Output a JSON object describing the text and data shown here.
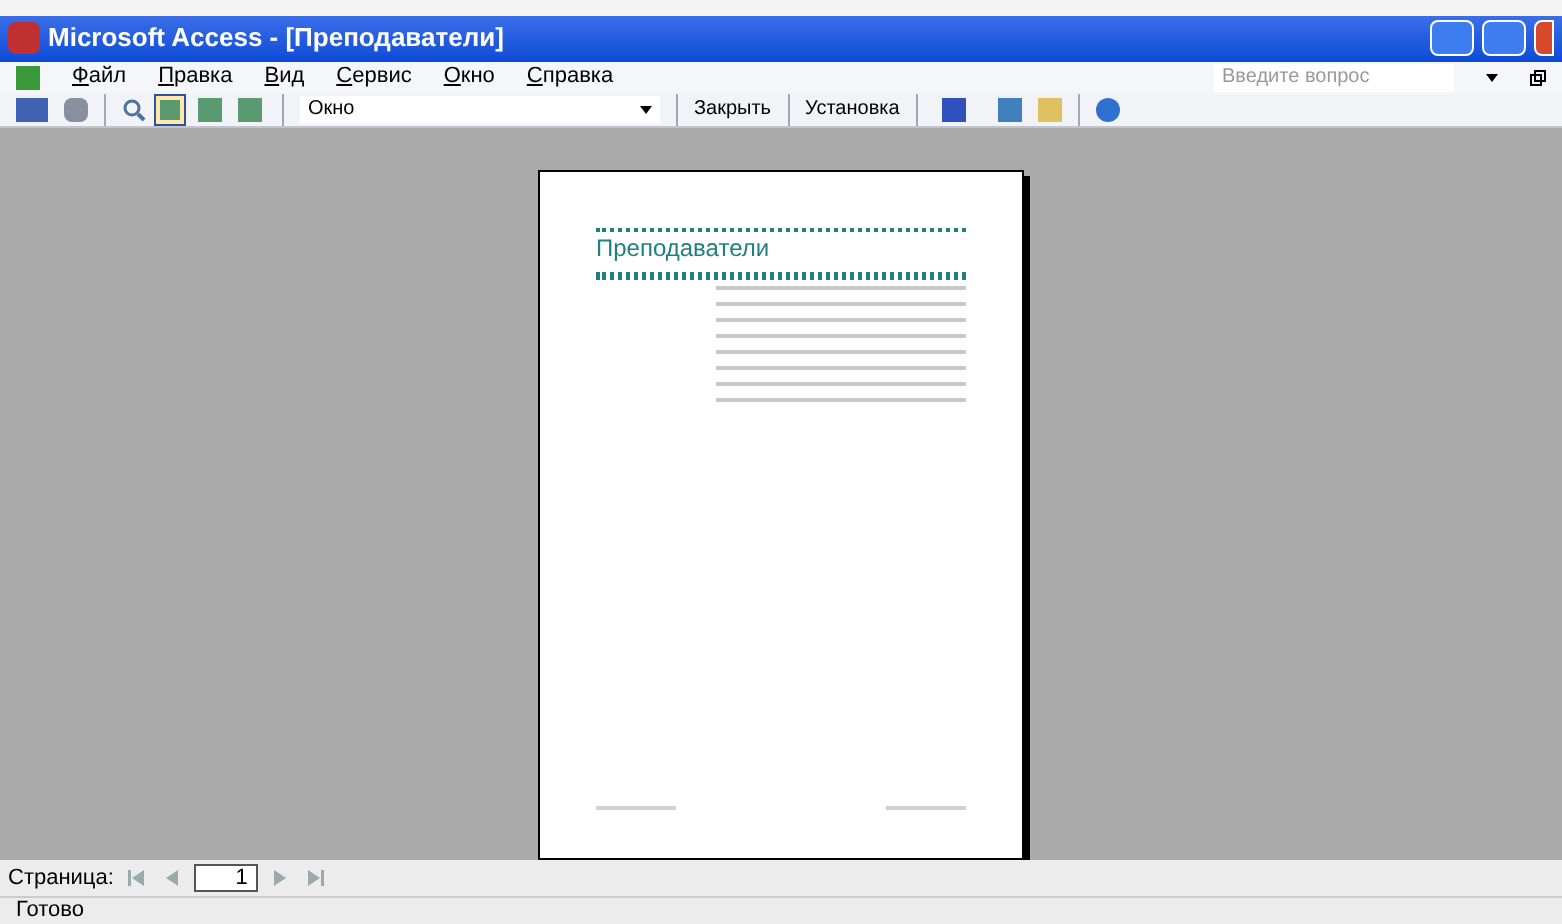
{
  "window": {
    "title": "Microsoft Access - [Преподаватели]"
  },
  "menu": [
    {
      "key": "Ф",
      "rest": "айл"
    },
    {
      "key": "П",
      "rest": "равка"
    },
    {
      "key": "В",
      "rest": "ид"
    },
    {
      "key": "С",
      "rest": "ервис"
    },
    {
      "key": "О",
      "rest": "кно"
    },
    {
      "key": "С",
      "rest": "правка"
    }
  ],
  "help_search": {
    "placeholder": "Введите вопрос"
  },
  "toolbar": {
    "zoom": "Окно",
    "close": "Закрыть",
    "setup": "Установка",
    "views": [
      {
        "selected": true
      },
      {
        "selected": false
      },
      {
        "selected": false
      }
    ]
  },
  "report": {
    "title": "Преподаватели"
  },
  "navigation": {
    "label": "Страница:",
    "page": "1"
  },
  "status_bar": "Готово"
}
